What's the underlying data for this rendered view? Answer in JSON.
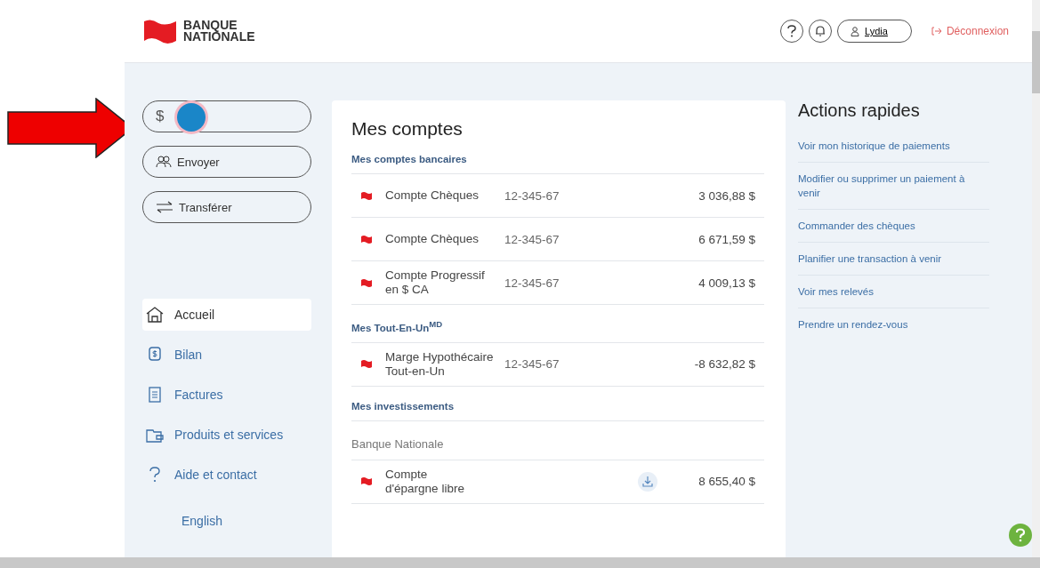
{
  "header": {
    "logo": [
      "BANQUE",
      "NATIONALE"
    ],
    "user": "Lydia",
    "logout": "Déconnexion"
  },
  "sidebar": {
    "actions": [
      {
        "kind": "pay",
        "glyph": "$",
        "covered": true
      },
      {
        "kind": "send",
        "label": "Envoyer"
      },
      {
        "kind": "transfer",
        "label": "Transférer"
      }
    ],
    "nav": [
      {
        "kind": "home",
        "label": "Accueil",
        "selected": true
      },
      {
        "kind": "balance",
        "label": "Bilan",
        "selected": false
      },
      {
        "kind": "bills",
        "label": "Factures",
        "selected": false
      },
      {
        "kind": "products",
        "label": "Produits et services",
        "selected": false
      },
      {
        "kind": "help",
        "label": "Aide et contact",
        "selected": false
      }
    ],
    "language": "English"
  },
  "accounts": {
    "title": "Mes comptes",
    "sections": [
      {
        "heading": "Mes comptes bancaires",
        "rows": [
          {
            "name": [
              "Compte Chèques"
            ],
            "number": "12-345-67",
            "amount": "3 036,88 $"
          },
          {
            "name": [
              "Compte Chèques"
            ],
            "number": "12-345-67",
            "amount": "6 671,59 $"
          },
          {
            "name": [
              "Compte Progressif",
              "en $ CA"
            ],
            "number": "12-345-67",
            "amount": "4 009,13 $"
          }
        ]
      },
      {
        "heading": "Mes Tout-En-Un$^{MD}$",
        "rows": [
          {
            "name": [
              "Marge Hypothécaire",
              "Tout-en-Un"
            ],
            "number": "12-345-67",
            "amount": "-8 632,82 $"
          }
        ]
      },
      {
        "heading": "Mes investissements",
        "subheading": "Banque Nationale",
        "rows": [
          {
            "name": [
              "Compte",
              "d'épargne libre"
            ],
            "amount": "8 655,40 $",
            "download": true
          }
        ]
      }
    ]
  },
  "quick_actions": {
    "title": "Actions rapides",
    "links": [
      "Voir mon historique de paiements",
      "Modifier ou supprimer un paiement à venir",
      "Commander des chèques",
      "Planifier une transaction à venir",
      "Voir mes relevés",
      "Prendre un rendez-vous"
    ]
  },
  "annotation": {
    "arrow": true,
    "cursor": true
  }
}
